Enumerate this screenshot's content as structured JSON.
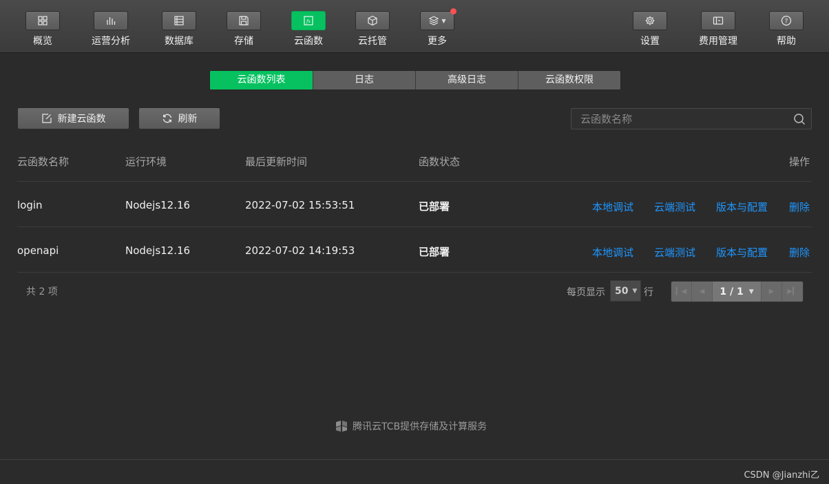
{
  "toolbar": {
    "items": [
      {
        "label": "概览",
        "icon": "overview-icon"
      },
      {
        "label": "运营分析",
        "icon": "analytics-icon"
      },
      {
        "label": "数据库",
        "icon": "database-icon"
      },
      {
        "label": "存储",
        "icon": "storage-icon"
      },
      {
        "label": "云函数",
        "icon": "cloud-function-icon",
        "active": true
      },
      {
        "label": "云托管",
        "icon": "cloud-hosting-icon"
      },
      {
        "label": "更多",
        "icon": "layers-icon"
      }
    ],
    "right_items": [
      {
        "label": "设置",
        "icon": "gear-icon"
      },
      {
        "label": "费用管理",
        "icon": "wallet-icon"
      },
      {
        "label": "帮助",
        "icon": "help-icon"
      }
    ],
    "active_color": "#07c160",
    "notification_color": "#fa5151"
  },
  "tabs": [
    {
      "label": "云函数列表",
      "active": true
    },
    {
      "label": "日志"
    },
    {
      "label": "高级日志"
    },
    {
      "label": "云函数权限"
    }
  ],
  "actions": {
    "new_label": "新建云函数",
    "refresh_label": "刷新"
  },
  "search": {
    "placeholder": "云函数名称",
    "value": ""
  },
  "table": {
    "headers": [
      "云函数名称",
      "运行环境",
      "最后更新时间",
      "函数状态",
      "操作"
    ],
    "rows": [
      {
        "name": "login",
        "runtime": "Nodejs12.16",
        "updated": "2022-07-02 15:53:51",
        "status": "已部署"
      },
      {
        "name": "openapi",
        "runtime": "Nodejs12.16",
        "updated": "2022-07-02 14:19:53",
        "status": "已部署"
      }
    ],
    "row_actions": [
      "本地调试",
      "云端测试",
      "版本与配置",
      "删除"
    ],
    "link_color": "#1e96ff"
  },
  "pagination": {
    "total_text": "共 2 项",
    "per_page_label": "每页显示",
    "per_page_value": "50",
    "row_label": "行",
    "page_text": "1 / 1"
  },
  "footer": {
    "text": "腾讯云TCB提供存储及计算服务"
  },
  "watermark": "CSDN @Jianzhi乙"
}
